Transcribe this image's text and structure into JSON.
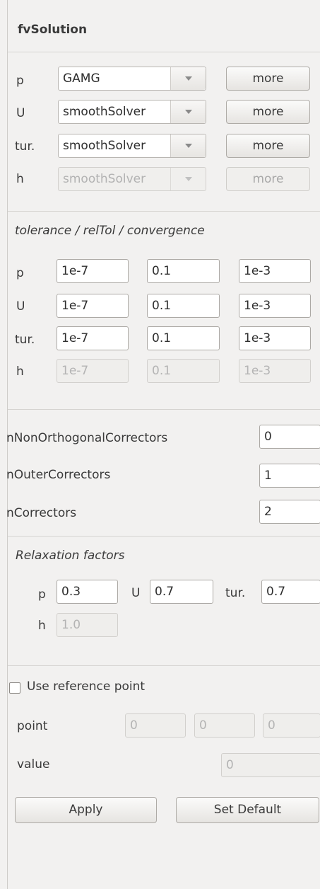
{
  "title": "fvSolution",
  "solvers": {
    "rows": [
      {
        "label": "p",
        "value": "GAMG",
        "more": "more"
      },
      {
        "label": "U",
        "value": "smoothSolver",
        "more": "more"
      },
      {
        "label": "tur.",
        "value": "smoothSolver",
        "more": "more"
      },
      {
        "label": "h",
        "value": "smoothSolver",
        "more": "more"
      }
    ]
  },
  "tolerance": {
    "heading": "tolerance / relTol / convergence",
    "rows": [
      {
        "label": "p",
        "tol": "1e-7",
        "rel": "0.1",
        "conv": "1e-3"
      },
      {
        "label": "U",
        "tol": "1e-7",
        "rel": "0.1",
        "conv": "1e-3"
      },
      {
        "label": "tur.",
        "tol": "1e-7",
        "rel": "0.1",
        "conv": "1e-3"
      },
      {
        "label": "h",
        "tol": "1e-7",
        "rel": "0.1",
        "conv": "1e-3"
      }
    ]
  },
  "correctors": {
    "non_orth_label": "nNonOrthogonalCorrectors",
    "non_orth": "0",
    "outer_label": "nOuterCorrectors",
    "outer": "1",
    "corr_label": "nCorrectors",
    "corr": "2"
  },
  "relaxation": {
    "heading": "Relaxation factors",
    "p_label": "p",
    "p": "0.3",
    "u_label": "U",
    "u": "0.7",
    "tur_label": "tur.",
    "tur": "0.7",
    "h_label": "h",
    "h": "1.0"
  },
  "reference": {
    "checkbox_label": "Use reference point",
    "checked": false,
    "point_label": "point",
    "point": [
      "0",
      "0",
      "0"
    ],
    "value_label": "value",
    "value": "0"
  },
  "buttons": {
    "apply": "Apply",
    "set_default": "Set Default"
  }
}
